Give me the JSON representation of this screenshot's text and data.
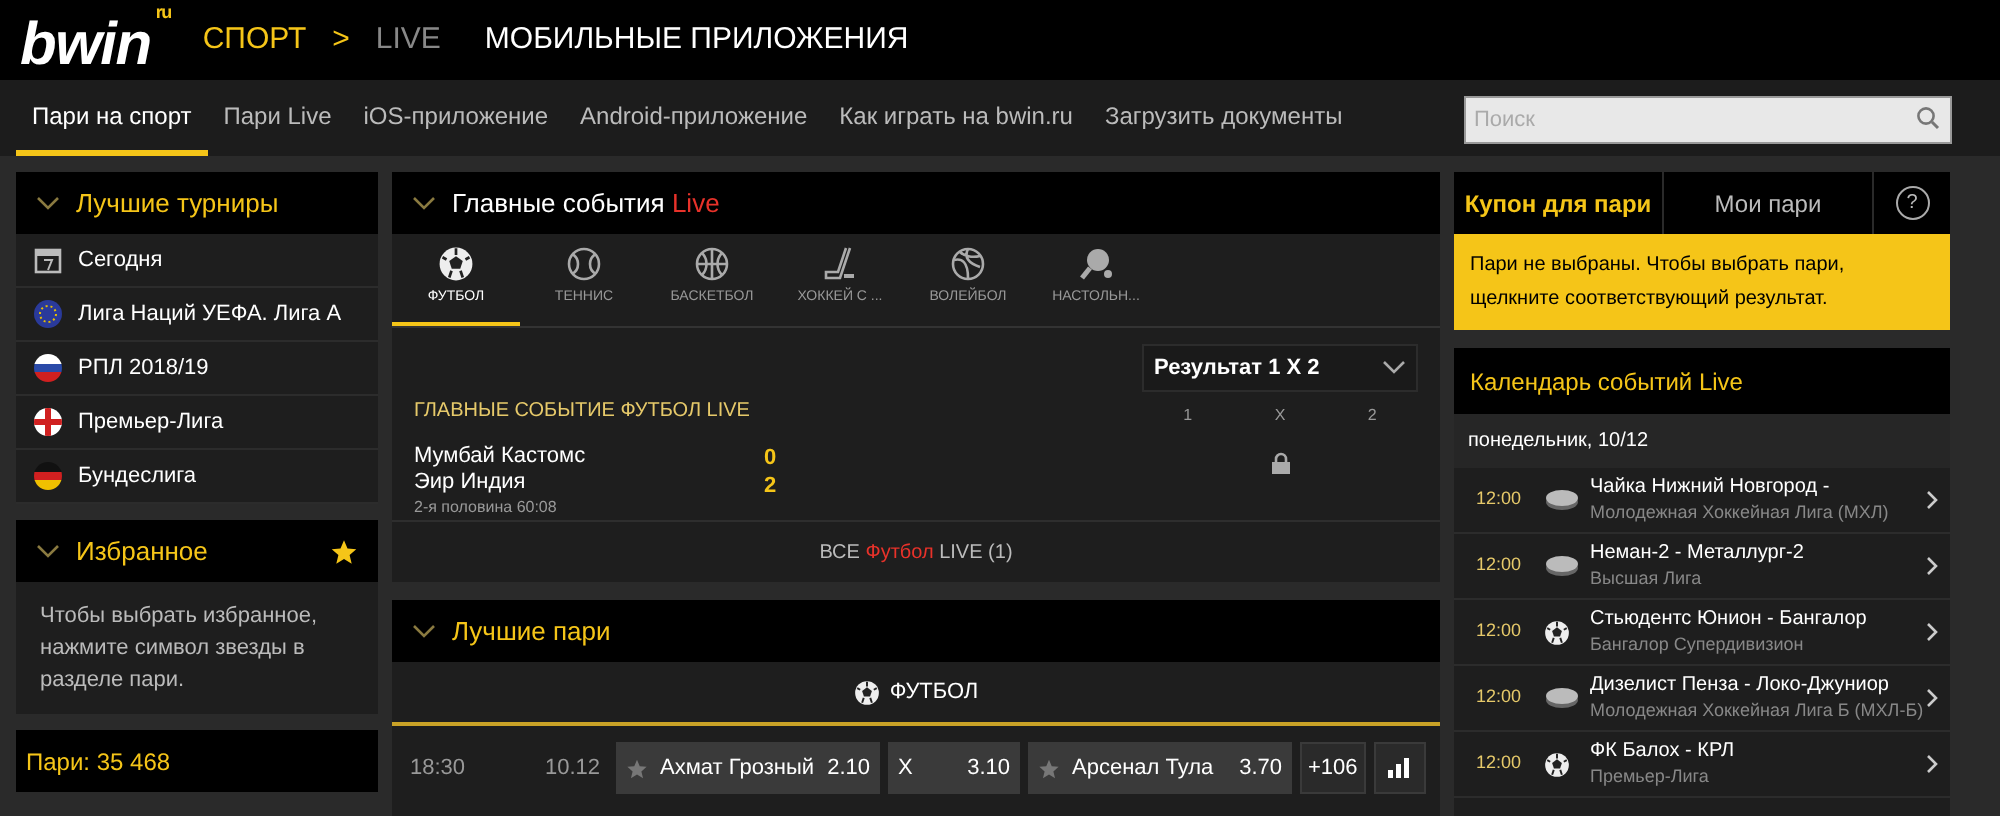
{
  "header": {
    "logo": "bwin",
    "logo_suffix": "ru",
    "nav": [
      {
        "label": "СПОРТ",
        "selected": true
      },
      {
        "label": "LIVE",
        "selected": false
      }
    ],
    "separator": ">",
    "extra": "МОБИЛЬНЫЕ ПРИЛОЖЕНИЯ"
  },
  "subnav": {
    "items": [
      {
        "label": "Пари на спорт",
        "selected": true
      },
      {
        "label": "Пари Live",
        "selected": false
      },
      {
        "label": "iOS-приложение",
        "selected": false
      },
      {
        "label": "Android-приложение",
        "selected": false
      },
      {
        "label": "Как играть на bwin.ru",
        "selected": false
      },
      {
        "label": "Загрузить документы",
        "selected": false
      }
    ],
    "search": {
      "placeholder": "Поиск"
    }
  },
  "tournaments": {
    "title": "Лучшие турниры",
    "items": [
      {
        "label": "Сегодня",
        "kind": "calendar"
      },
      {
        "label": "Лига Наций УЕФА. Лига А",
        "kind": "eu"
      },
      {
        "label": "РПЛ 2018/19",
        "kind": "ru"
      },
      {
        "label": "Премьер-Лига",
        "kind": "en"
      },
      {
        "label": "Бундеслига",
        "kind": "de"
      }
    ]
  },
  "favorites": {
    "title": "Избранное",
    "text": "Чтобы выбрать избранное, нажмите символ звезды в разделе пари."
  },
  "bets_count": "Пари: 35 468",
  "live": {
    "title": "Главные события",
    "title_accent": "Live",
    "tabs": [
      {
        "label": "ФУТБОЛ",
        "kind": "football",
        "selected": true
      },
      {
        "label": "ТЕННИС",
        "kind": "tennis",
        "selected": false
      },
      {
        "label": "БАСКЕТБОЛ",
        "kind": "basketball",
        "selected": false
      },
      {
        "label": "ХОККЕЙ С ...",
        "kind": "hockey",
        "selected": false
      },
      {
        "label": "ВОЛЕЙБОЛ",
        "kind": "volleyball",
        "selected": false
      },
      {
        "label": "НАСТОЛЬН...",
        "kind": "tabletennis",
        "selected": false
      }
    ],
    "market": "Результат 1 X 2",
    "section": "ГЛАВНЫЕ СОБЫТИЕ ФУТБОЛ LIVE",
    "columns": [
      "1",
      "X",
      "2"
    ],
    "match": {
      "team1": "Мумбай Кастомс",
      "team2": "Эир Индия",
      "score1": "0",
      "score2": "2",
      "period": "2-я половина",
      "clock": "60:08",
      "locked": true
    },
    "footer": {
      "prefix": "ВСЕ",
      "accent": "Футбол",
      "suffix": "LIVE (1)"
    }
  },
  "top_bets": {
    "title": "Лучшие пари",
    "sport": "ФУТБОЛ",
    "rows": [
      {
        "time": "18:30",
        "date": "10.12",
        "odds": [
          {
            "label": "Ахмат Грозный",
            "value": "2.10",
            "star": true
          },
          {
            "label": "X",
            "value": "3.10",
            "star": false
          },
          {
            "label": "Арсенал Тула",
            "value": "3.70",
            "star": true
          }
        ],
        "more": "+106"
      }
    ]
  },
  "coupon": {
    "tabs": [
      {
        "label": "Купон для пари",
        "selected": true
      },
      {
        "label": "Мои пари",
        "selected": false
      }
    ],
    "help": "?",
    "message": "Пари не выбраны. Чтобы выбрать пари, щелкните соответствующий результат."
  },
  "calendar": {
    "title": "Календарь событий Live",
    "date": "понедельник, 10/12",
    "events": [
      {
        "time": "12:00",
        "kind": "hockey",
        "name": "Чайка Нижний Новгород -",
        "league": "Молодежная Хоккейная Лига (МХЛ)"
      },
      {
        "time": "12:00",
        "kind": "hockey",
        "name": "Неман-2 - Металлург-2",
        "league": "Высшая Лига"
      },
      {
        "time": "12:00",
        "kind": "football",
        "name": "Стьюдентс Юнион - Бангалор",
        "league": "Бангалор Супердивизион"
      },
      {
        "time": "12:00",
        "kind": "hockey",
        "name": "Дизелист Пенза - Локо-Джуниор",
        "league": "Молодежная Хоккейная Лига Б (МХЛ-Б)"
      },
      {
        "time": "12:00",
        "kind": "football",
        "name": "ФК Балох - КРЛ",
        "league": "Премьер-Лига"
      }
    ]
  }
}
